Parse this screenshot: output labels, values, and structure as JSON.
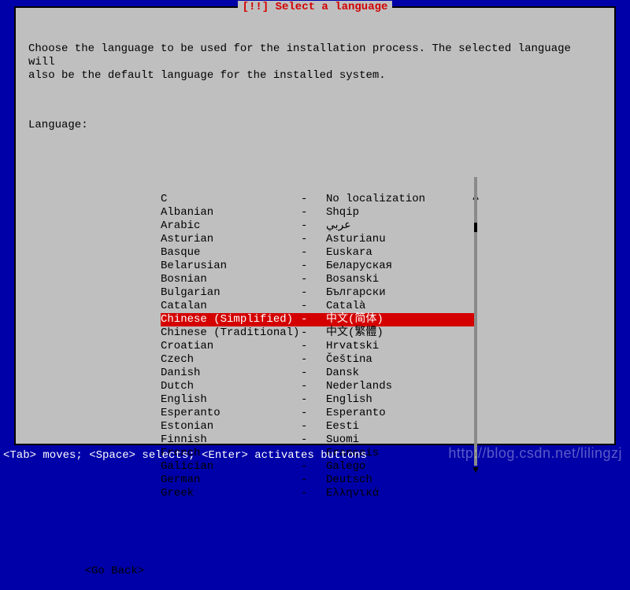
{
  "dialog": {
    "title": "[!!] Select a language",
    "instructions": "Choose the language to be used for the installation process. The selected language will\nalso be the default language for the installed system.",
    "label": "Language:",
    "back_button": "<Go Back>",
    "selected_index": 9,
    "languages": [
      {
        "en": "C",
        "native": "No localization"
      },
      {
        "en": "Albanian",
        "native": "Shqip"
      },
      {
        "en": "Arabic",
        "native": "عربي"
      },
      {
        "en": "Asturian",
        "native": "Asturianu"
      },
      {
        "en": "Basque",
        "native": "Euskara"
      },
      {
        "en": "Belarusian",
        "native": "Беларуская"
      },
      {
        "en": "Bosnian",
        "native": "Bosanski"
      },
      {
        "en": "Bulgarian",
        "native": "Български"
      },
      {
        "en": "Catalan",
        "native": "Català"
      },
      {
        "en": "Chinese (Simplified)",
        "native": "中文(简体)"
      },
      {
        "en": "Chinese (Traditional)",
        "native": "中文(繁體)"
      },
      {
        "en": "Croatian",
        "native": "Hrvatski"
      },
      {
        "en": "Czech",
        "native": "Čeština"
      },
      {
        "en": "Danish",
        "native": "Dansk"
      },
      {
        "en": "Dutch",
        "native": "Nederlands"
      },
      {
        "en": "English",
        "native": "English"
      },
      {
        "en": "Esperanto",
        "native": "Esperanto"
      },
      {
        "en": "Estonian",
        "native": "Eesti"
      },
      {
        "en": "Finnish",
        "native": "Suomi"
      },
      {
        "en": "French",
        "native": "Français"
      },
      {
        "en": "Galician",
        "native": "Galego"
      },
      {
        "en": "German",
        "native": "Deutsch"
      },
      {
        "en": "Greek",
        "native": "Ελληνικά"
      }
    ]
  },
  "status": "<Tab> moves; <Space> selects; <Enter> activates buttons",
  "watermark": "http://blog.csdn.net/lilingzj"
}
